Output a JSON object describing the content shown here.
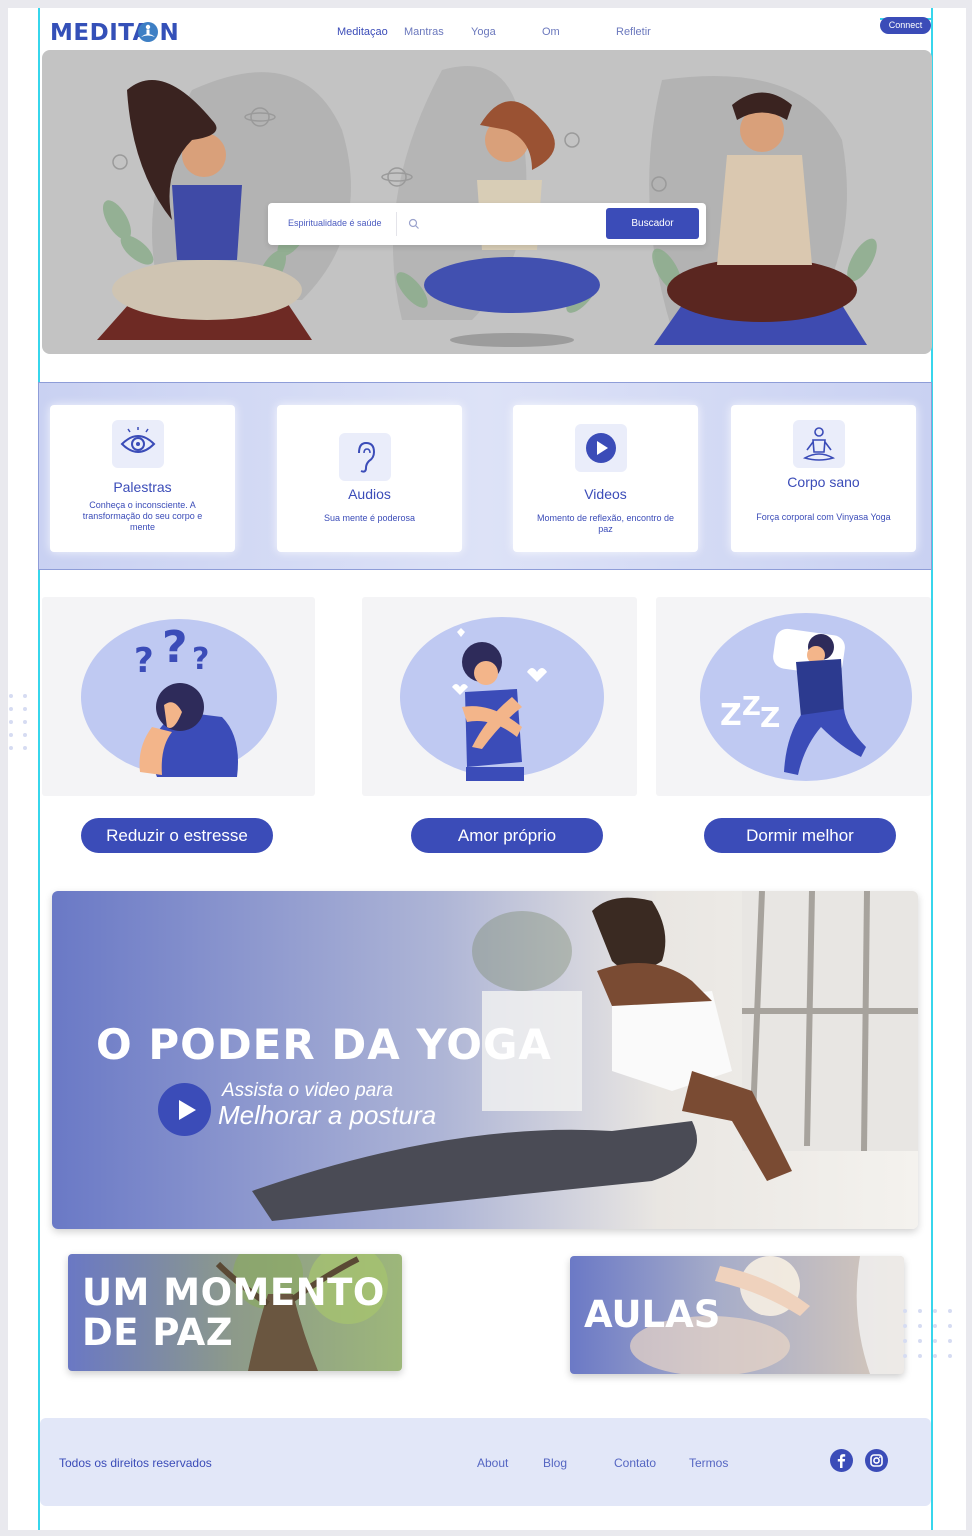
{
  "header": {
    "logo": "MEDITA  N",
    "nav": [
      "Meditaçao",
      "Mantras",
      "Yoga",
      "Om",
      "Refletir"
    ],
    "connect": "Connect"
  },
  "hero": {
    "search_category": "Espiritualidade é saúde",
    "search_placeholder": "",
    "search_button": "Buscador"
  },
  "features": [
    {
      "title": "Palestras",
      "desc": "Conheça o inconsciente. A transformação do seu corpo e mente",
      "icon": "eye-icon"
    },
    {
      "title": "Audios",
      "desc": "Sua mente é poderosa",
      "icon": "ear-icon"
    },
    {
      "title": "Videos",
      "desc": "Momento de reflexão, encontro de paz",
      "icon": "play-icon"
    },
    {
      "title": "Corpo sano",
      "desc": "Força corporal com Vinyasa Yoga",
      "icon": "meditation-icon"
    }
  ],
  "benefits": [
    "Reduzir o estresse",
    "Amor próprio",
    "Dormir melhor"
  ],
  "yoga": {
    "title": "O PODER DA YOGA",
    "sub1": "Assista o video para",
    "sub2": "Melhorar a postura"
  },
  "paz": {
    "line1": "UM MOMENTO",
    "line2": "DE PAZ"
  },
  "aulas": "AULAS",
  "footer": {
    "rights": "Todos os direitos reservados",
    "links": [
      "About",
      "Blog",
      "Contato",
      "Termos"
    ],
    "social": [
      "facebook-icon",
      "instagram-icon"
    ]
  },
  "colors": {
    "accent": "#3b4cb8",
    "band": "#c9d1f2",
    "footer": "#e2e7f8"
  }
}
